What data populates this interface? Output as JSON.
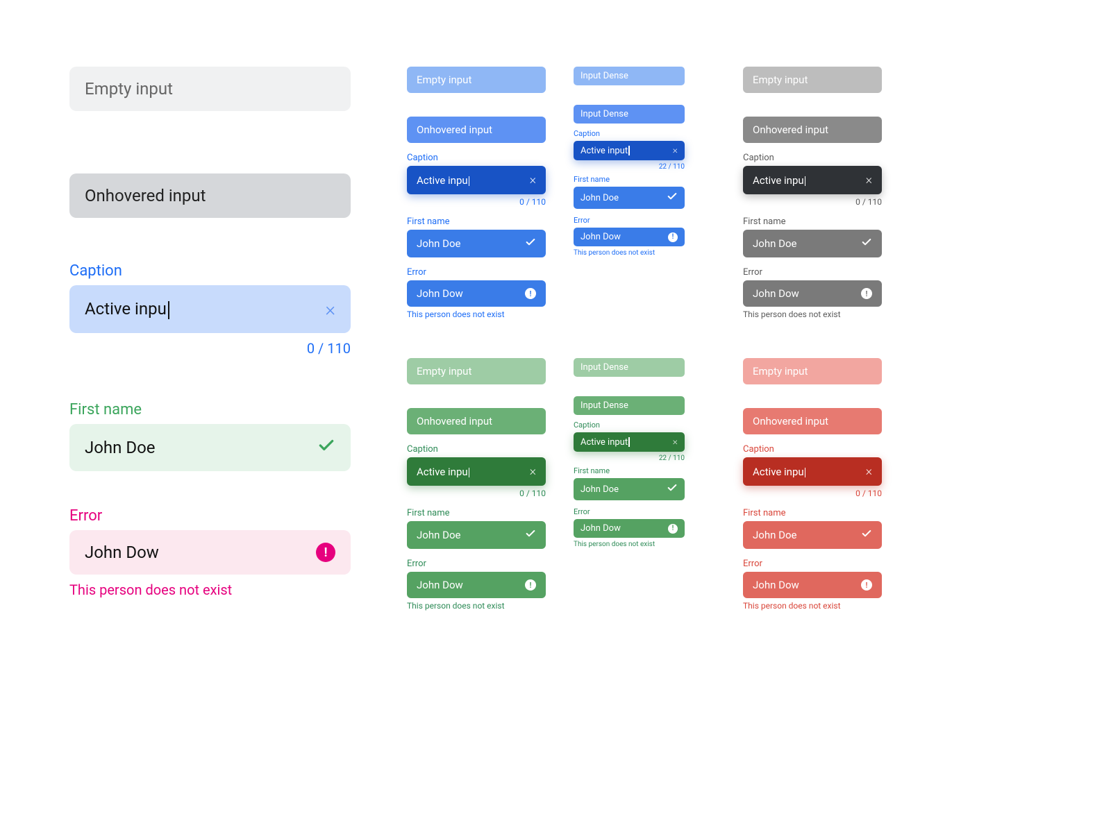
{
  "large": {
    "empty_placeholder": "Empty input",
    "hover_placeholder": "Onhovered input",
    "active": {
      "label": "Caption",
      "value": "Active inpu",
      "counter": "0 / 110"
    },
    "valid": {
      "label": "First name",
      "value": "John Doe"
    },
    "error": {
      "label": "Error",
      "value": "John Dow",
      "helper": "This person does not exist"
    }
  },
  "variant": {
    "empty_placeholder": "Empty input",
    "hover_placeholder": "Onhovered input",
    "active": {
      "label": "Caption",
      "value": "Active inpu",
      "counter": "0 / 110"
    },
    "valid": {
      "label": "First name",
      "value": "John Doe"
    },
    "error": {
      "label": "Error",
      "value": "John Dow",
      "helper": "This person does not exist"
    }
  },
  "dense": {
    "empty_placeholder": "Input Dense",
    "hover_placeholder": "Input Dense",
    "active": {
      "label": "Caption",
      "value": "Active input",
      "counter": "22 / 110"
    },
    "valid": {
      "label": "First name",
      "value": "John Doe"
    },
    "error": {
      "label": "Error",
      "value": "John Dow",
      "helper": "This person does not exist"
    }
  }
}
